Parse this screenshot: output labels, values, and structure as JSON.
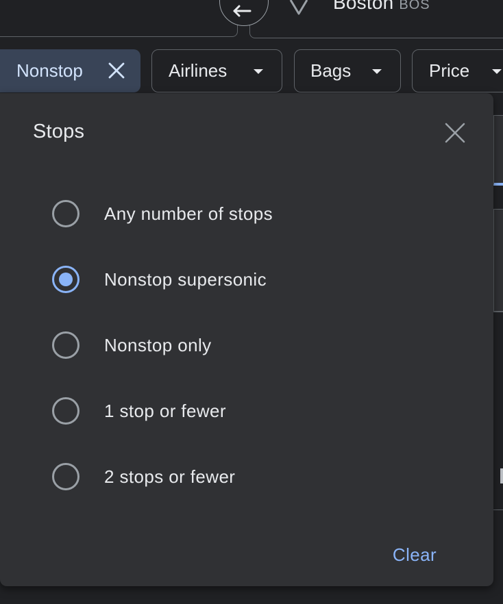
{
  "search": {
    "destination_city": "Boston",
    "destination_code": "BOS",
    "swap_icon": "swap-arrows-icon",
    "location_icon": "location-pin-icon"
  },
  "filters": {
    "active_chip": {
      "label": "Nonstop",
      "icon": "close-icon"
    },
    "chips": [
      {
        "label": "Airlines",
        "icon": "dropdown-caret-icon"
      },
      {
        "label": "Bags",
        "icon": "dropdown-caret-icon"
      },
      {
        "label": "Price",
        "icon": "dropdown-caret-icon"
      }
    ]
  },
  "stops_panel": {
    "title": "Stops",
    "close_icon": "close-icon",
    "selected_index": 1,
    "options": [
      {
        "label": "Any number of stops",
        "checked": false
      },
      {
        "label": "Nonstop supersonic",
        "checked": true
      },
      {
        "label": "Nonstop only",
        "checked": false
      },
      {
        "label": "1 stop or fewer",
        "checked": false
      },
      {
        "label": "2 stops or fewer",
        "checked": false
      }
    ],
    "clear_label": "Clear"
  },
  "colors": {
    "background": "#202124",
    "panel": "#303134",
    "accent": "#8ab4f8",
    "active_chip_bg": "#394457",
    "text": "#e8eaed",
    "muted": "#9aa0a6",
    "outline": "#5f6368"
  }
}
